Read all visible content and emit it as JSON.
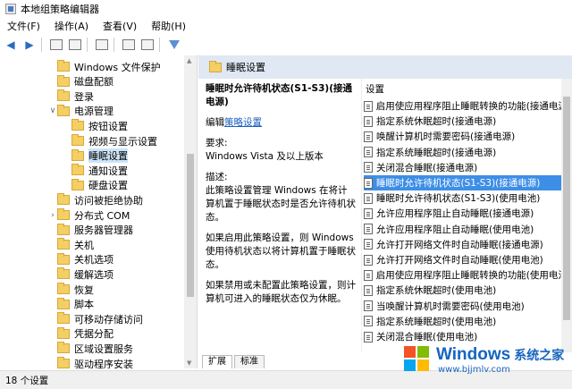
{
  "window": {
    "title": "本地组策略编辑器"
  },
  "menu": [
    "文件(F)",
    "操作(A)",
    "查看(V)",
    "帮助(H)"
  ],
  "tree": {
    "items": [
      {
        "label": "Windows 文件保护",
        "indent": 1,
        "arrow": "",
        "selected": false
      },
      {
        "label": "磁盘配额",
        "indent": 1,
        "arrow": "",
        "selected": false
      },
      {
        "label": "登录",
        "indent": 1,
        "arrow": "",
        "selected": false
      },
      {
        "label": "电源管理",
        "indent": 1,
        "arrow": "∨",
        "selected": false
      },
      {
        "label": "按钮设置",
        "indent": 2,
        "arrow": "",
        "selected": false
      },
      {
        "label": "视频与显示设置",
        "indent": 2,
        "arrow": "",
        "selected": false
      },
      {
        "label": "睡眠设置",
        "indent": 2,
        "arrow": "",
        "selected": true
      },
      {
        "label": "通知设置",
        "indent": 2,
        "arrow": "",
        "selected": false
      },
      {
        "label": "硬盘设置",
        "indent": 2,
        "arrow": "",
        "selected": false
      },
      {
        "label": "访问被拒绝协助",
        "indent": 1,
        "arrow": "",
        "selected": false
      },
      {
        "label": "分布式 COM",
        "indent": 1,
        "arrow": "›",
        "selected": false
      },
      {
        "label": "服务器管理器",
        "indent": 1,
        "arrow": "",
        "selected": false
      },
      {
        "label": "关机",
        "indent": 1,
        "arrow": "",
        "selected": false
      },
      {
        "label": "关机选项",
        "indent": 1,
        "arrow": "",
        "selected": false
      },
      {
        "label": "缓解选项",
        "indent": 1,
        "arrow": "",
        "selected": false
      },
      {
        "label": "恢复",
        "indent": 1,
        "arrow": "",
        "selected": false
      },
      {
        "label": "脚本",
        "indent": 1,
        "arrow": "",
        "selected": false
      },
      {
        "label": "可移动存储访问",
        "indent": 1,
        "arrow": "",
        "selected": false
      },
      {
        "label": "凭据分配",
        "indent": 1,
        "arrow": "",
        "selected": false
      },
      {
        "label": "区域设置服务",
        "indent": 1,
        "arrow": "",
        "selected": false
      },
      {
        "label": "驱动程序安装",
        "indent": 1,
        "arrow": "",
        "selected": false
      }
    ]
  },
  "right": {
    "header": "睡眠设置",
    "desc": {
      "title": "睡眠时允许待机状态(S1-S3)(接通电源)",
      "edit_prefix": "编辑",
      "edit_link": "策略设置",
      "req_label": "要求:",
      "req_value": "Windows Vista 及以上版本",
      "desc_label": "描述:",
      "desc_text": "此策略设置管理 Windows 在将计算机置于睡眠状态时是否允许待机状态。",
      "enabled_text": "如果启用此策略设置，则 Windows 使用待机状态以将计算机置于睡眠状态。",
      "disabled_text": "如果禁用或未配置此策略设置，则计算机可进入的睡眠状态仅为休眠。"
    },
    "list_header": "设置",
    "settings": [
      {
        "label": "启用使应用程序阻止睡眠转换的功能(接通电源)",
        "selected": false
      },
      {
        "label": "指定系统休眠超时(接通电源)",
        "selected": false
      },
      {
        "label": "唤醒计算机时需要密码(接通电源)",
        "selected": false
      },
      {
        "label": "指定系统睡眠超时(接通电源)",
        "selected": false
      },
      {
        "label": "关闭混合睡眠(接通电源)",
        "selected": false
      },
      {
        "label": "睡眠时允许待机状态(S1-S3)(接通电源)",
        "selected": true
      },
      {
        "label": "睡眠时允许待机状态(S1-S3)(使用电池)",
        "selected": false
      },
      {
        "label": "允许应用程序阻止自动睡眠(接通电源)",
        "selected": false
      },
      {
        "label": "允许应用程序阻止自动睡眠(使用电池)",
        "selected": false
      },
      {
        "label": "允许打开网络文件时自动睡眠(接通电源)",
        "selected": false
      },
      {
        "label": "允许打开网络文件时自动睡眠(使用电池)",
        "selected": false
      },
      {
        "label": "启用使应用程序阻止睡眠转换的功能(使用电池)",
        "selected": false
      },
      {
        "label": "指定系统休眠超时(使用电池)",
        "selected": false
      },
      {
        "label": "当唤醒计算机时需要密码(使用电池)",
        "selected": false
      },
      {
        "label": "指定系统睡眠超时(使用电池)",
        "selected": false
      },
      {
        "label": "关闭混合睡眠(使用电池)",
        "selected": false
      }
    ],
    "tabs": [
      "扩展",
      "标准"
    ]
  },
  "status": "18 个设置",
  "watermark": {
    "brand": "Windows",
    "brand_cn": "系统之家",
    "url": "www.bjjmlv.com"
  }
}
